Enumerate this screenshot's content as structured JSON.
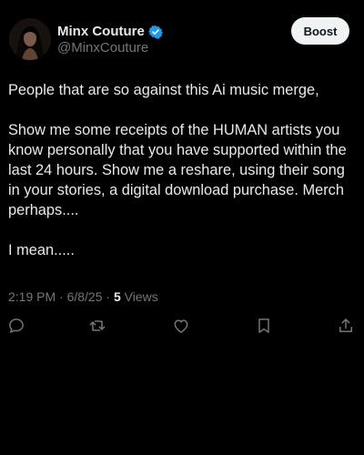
{
  "author": {
    "name": "Minx Couture",
    "handle": "@MinxCouture",
    "verified_color": "#1d9bf0",
    "avatar_icon": "profile-photo"
  },
  "header": {
    "boost_label": "Boost"
  },
  "post": {
    "paragraphs": [
      "People that are so against this Ai music merge,",
      "Show me some receipts of the HUMAN artists you know personally that you have supported within the last 24 hours. Show me a reshare, using their song in your stories, a digital download purchase. Merch perhaps....",
      "I mean....."
    ],
    "timestamp": "2:19 PM · 6/8/25 · ",
    "views_count": "5",
    "views_label": " Views"
  },
  "actions": [
    {
      "icon": "reply-icon"
    },
    {
      "icon": "repost-icon"
    },
    {
      "icon": "like-icon"
    },
    {
      "icon": "bookmark-icon"
    },
    {
      "icon": "share-icon"
    }
  ],
  "colors": {
    "background": "#000000",
    "text": "#e7e9ea",
    "secondary_text": "#71767b",
    "button_bg": "#eff3f4"
  }
}
